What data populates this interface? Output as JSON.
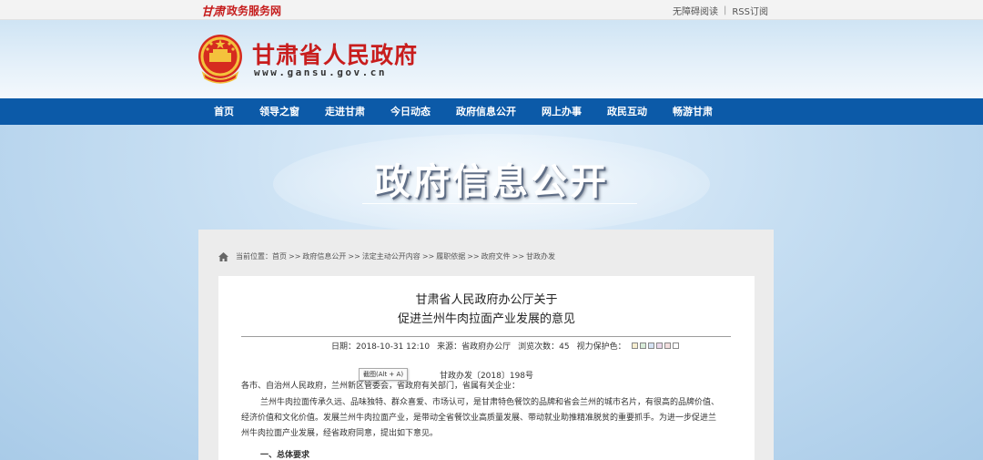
{
  "topbar": {
    "logo_script": "甘肃",
    "brand_name": "政务服务网",
    "accessibility_link": "无障碍阅读",
    "separator": "|",
    "rss_link": "RSS订阅"
  },
  "header": {
    "site_title": "甘肃省人民政府",
    "site_url": "www.gansu.gov.cn"
  },
  "nav": {
    "items": [
      "首页",
      "领导之窗",
      "走进甘肃",
      "今日动态",
      "政府信息公开",
      "网上办事",
      "政民互动",
      "畅游甘肃"
    ]
  },
  "banner": {
    "title": "政府信息公开"
  },
  "breadcrumb": {
    "prefix": "当前位置：",
    "crumbs": [
      "首页",
      "政府信息公开",
      "法定主动公开内容",
      "履职依据",
      "政府文件",
      "甘政办发"
    ],
    "arrow": ">>"
  },
  "document": {
    "title_line1": "甘肃省人民政府办公厅关于",
    "title_line2": "促进兰州牛肉拉面产业发展的意见",
    "date": "日期：2018-10-31 12:10",
    "source": "来源：省政府办公厅",
    "views": "浏览次数：45",
    "eye_protection_label": "视力保护色：",
    "swatch_colors": [
      "#f7eed0",
      "#d8ecd9",
      "#d4e2f3",
      "#ead7ea",
      "#f3dede",
      "#ffffff"
    ],
    "doc_number": "甘政办发〔2018〕198号",
    "tooltip": "截图(Alt + A)",
    "paragraphs": [
      "各市、自治州人民政府，兰州新区管委会，省政府有关部门，省属有关企业：",
      "兰州牛肉拉面传承久远、品味独特、群众喜爱、市场认可，是甘肃特色餐饮的品牌和省会兰州的城市名片，有很高的品牌价值、",
      "经济价值和文化价值。发展兰州牛肉拉面产业，是带动全省餐饮业高质量发展、带动就业助推精准脱贫的重要抓手。为进一步促进兰",
      "州牛肉拉面产业发展，经省政府同意，提出如下意见。",
      "一、总体要求"
    ]
  }
}
